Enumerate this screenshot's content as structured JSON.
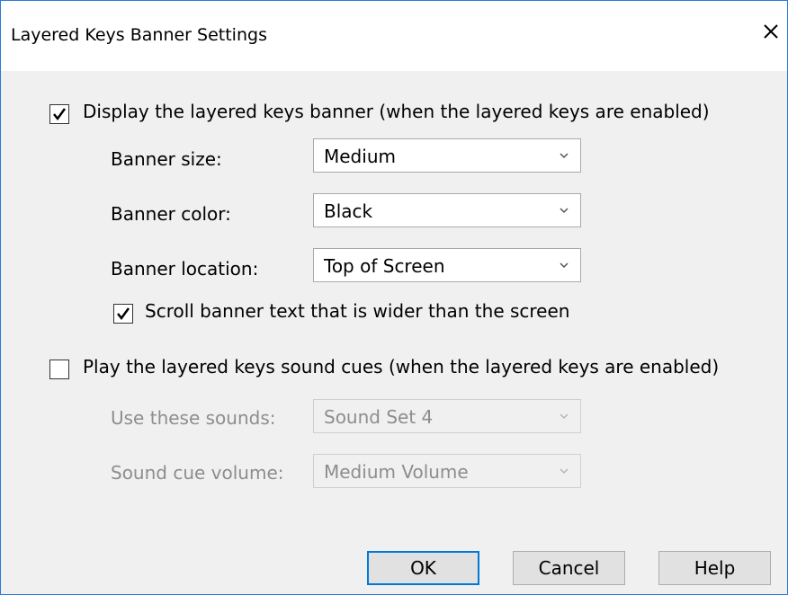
{
  "window": {
    "title": "Layered Keys Banner Settings"
  },
  "banner": {
    "display_checked": true,
    "display_label": "Display the layered keys banner (when the layered keys are enabled)",
    "size_label": "Banner size:",
    "size_value": "Medium",
    "color_label": "Banner color:",
    "color_value": "Black",
    "location_label": "Banner location:",
    "location_value": "Top of Screen",
    "scroll_checked": true,
    "scroll_label": "Scroll banner text that is wider than the screen"
  },
  "sound": {
    "play_checked": false,
    "play_label": "Play the layered keys sound cues (when the layered keys are enabled)",
    "sounds_label": "Use these sounds:",
    "sounds_value": "Sound Set 4",
    "volume_label": "Sound cue volume:",
    "volume_value": "Medium Volume"
  },
  "buttons": {
    "ok": "OK",
    "cancel": "Cancel",
    "help": "Help"
  },
  "colors": {
    "accent": "#0078d7",
    "border": "#2b79d6"
  }
}
